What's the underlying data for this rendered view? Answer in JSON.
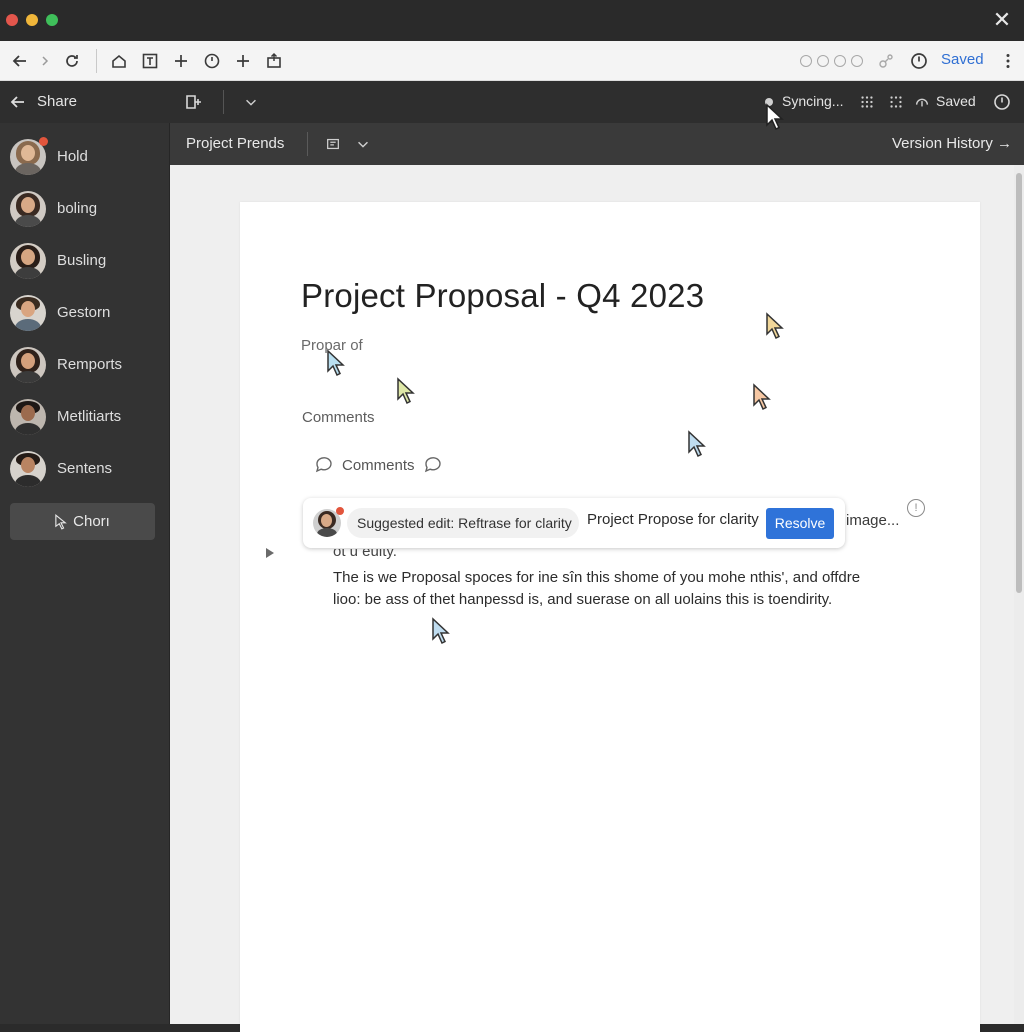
{
  "window": {
    "close_label": "✕",
    "traffic_colors": [
      "#e3564c",
      "#f0b63a",
      "#3fbf5a"
    ]
  },
  "browser": {
    "saved_label": "Saved"
  },
  "appbar": {
    "share_label": "Share",
    "syncing_label": "Syncing...",
    "saved_label": "Saved"
  },
  "sidebar": {
    "people": [
      {
        "name": "Hold",
        "notify": true
      },
      {
        "name": "boling",
        "notify": false
      },
      {
        "name": "Busling",
        "notify": false
      },
      {
        "name": "Gestorn",
        "notify": false
      },
      {
        "name": "Remports",
        "notify": false
      },
      {
        "name": "Metlitiarts",
        "notify": false
      },
      {
        "name": "Sentens",
        "notify": false
      }
    ],
    "chon_label": "Chorı"
  },
  "docbar": {
    "project_label": "Project Prends",
    "version_history_label": "Version History →"
  },
  "document": {
    "title": "Project Proposal - Q4 2023",
    "subtitle": "Propar of",
    "comments_heading": "Comments",
    "comments_row_label": "Comments",
    "suggestion": {
      "pill_text": "Suggested edit: Reftrase for clarity",
      "text": "Project Propose for clarity",
      "resolve_label": "Resolve"
    },
    "image_label": "image...",
    "info_label": "!",
    "cut_line": "ot u euity.",
    "body": "The is we Proposal spoces for ine sîn this shome of you mohe nthis', and offdre lioo: be ass of thet hanpessd is, and suerase on all uolains this is toendirity."
  },
  "colors": {
    "accent_blue": "#2f73d9",
    "cursor_colors": [
      "#b9dff0",
      "#f1d79a",
      "#dfe8a8",
      "#f6c7a3",
      "#bfdcef",
      "#ffffff"
    ]
  }
}
